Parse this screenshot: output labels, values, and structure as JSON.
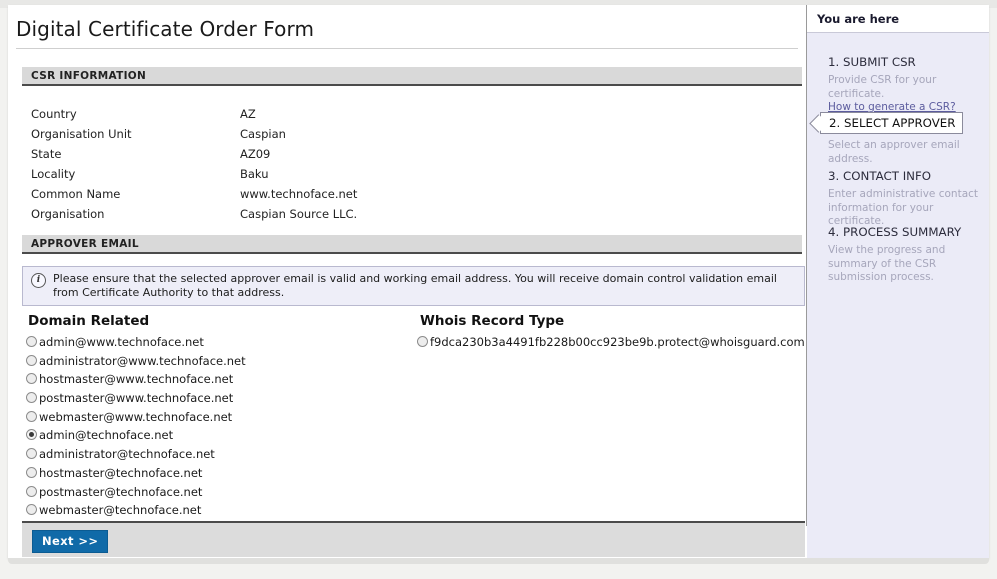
{
  "page": {
    "title": "Digital Certificate Order Form"
  },
  "sections": {
    "csr": {
      "heading": "CSR INFORMATION",
      "rows": [
        {
          "label": "Country",
          "value": "AZ"
        },
        {
          "label": "Organisation Unit",
          "value": "Caspian"
        },
        {
          "label": "State",
          "value": "AZ09"
        },
        {
          "label": "Locality",
          "value": "Baku"
        },
        {
          "label": "Common Name",
          "value": "www.technoface.net"
        },
        {
          "label": "Organisation",
          "value": "Caspian Source LLC."
        }
      ]
    },
    "approver": {
      "heading": "APPROVER EMAIL",
      "notice": "Please ensure that the selected approver email is valid and working email address. You will receive domain control validation email from Certificate Authority to that address.",
      "notice_icon": "info-icon",
      "domain_related": {
        "heading": "Domain Related",
        "options": [
          {
            "label": "admin@www.technoface.net",
            "selected": false
          },
          {
            "label": "administrator@www.technoface.net",
            "selected": false
          },
          {
            "label": "hostmaster@www.technoface.net",
            "selected": false
          },
          {
            "label": "postmaster@www.technoface.net",
            "selected": false
          },
          {
            "label": "webmaster@www.technoface.net",
            "selected": false
          },
          {
            "label": "admin@technoface.net",
            "selected": true
          },
          {
            "label": "administrator@technoface.net",
            "selected": false
          },
          {
            "label": "hostmaster@technoface.net",
            "selected": false
          },
          {
            "label": "postmaster@technoface.net",
            "selected": false
          },
          {
            "label": "webmaster@technoface.net",
            "selected": false
          }
        ]
      },
      "whois": {
        "heading": "Whois Record Type",
        "options": [
          {
            "label": "f9dca230b3a4491fb228b00cc923be9b.protect@whoisguard.com",
            "selected": false
          }
        ]
      }
    }
  },
  "footer": {
    "next_label": "Next >>"
  },
  "sidebar": {
    "title": "You are here",
    "steps": [
      {
        "title": "1. SUBMIT CSR",
        "desc": "Provide CSR for your certificate.",
        "link": "How to generate a CSR?",
        "active": false
      },
      {
        "title": "2. SELECT APPROVER",
        "desc": "Select an approver email address.",
        "link": "",
        "active": true
      },
      {
        "title": "3. CONTACT INFO",
        "desc": "Enter administrative contact information for your certificate.",
        "link": "",
        "active": false
      },
      {
        "title": "4. PROCESS SUMMARY",
        "desc": "View the progress and summary of the CSR submission process.",
        "link": "",
        "active": false
      }
    ]
  },
  "colors": {
    "accent_button": "#106aa8",
    "sidebar_bg": "#ebebf7",
    "section_bar": "#d9d9d9",
    "notice_bg": "#eeeef8"
  }
}
